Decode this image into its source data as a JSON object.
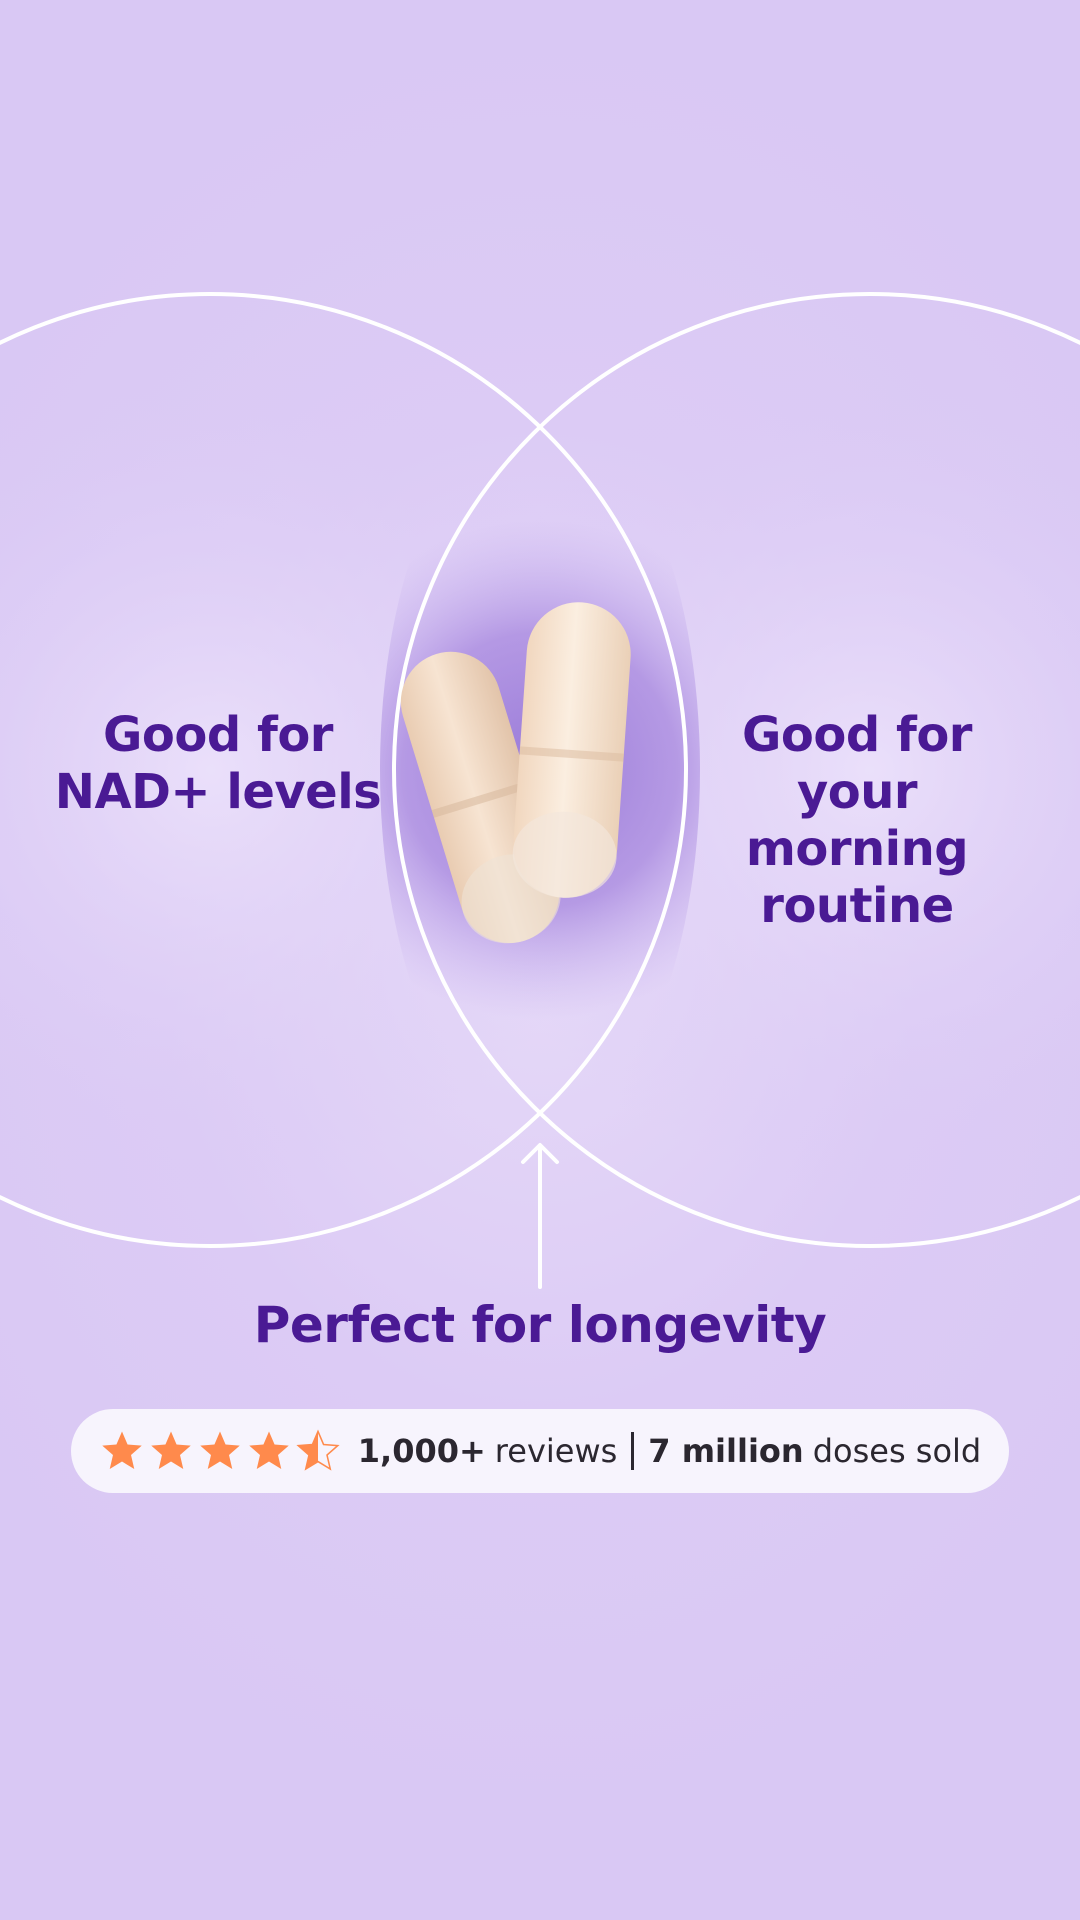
{
  "labels": {
    "left": "Good for\nNAD+ levels",
    "right": "Good for\nyour morning\nroutine",
    "bottom": "Perfect for longevity"
  },
  "rating": {
    "stars": 4.5,
    "reviews_count": "1,000+",
    "reviews_word": "reviews",
    "doses_count": "7 million",
    "doses_word": "doses sold"
  },
  "colors": {
    "background": "#d9c8f4",
    "label_text": "#4a1a94",
    "star": "#ff8a4c",
    "pill_bg": "#f7f4fd",
    "circle_stroke": "#ffffff",
    "capsule": "#f3dcc6"
  },
  "icons": {
    "capsules": "capsule-pills-image",
    "arrow": "arrow-up-icon",
    "star": "star-icon"
  }
}
